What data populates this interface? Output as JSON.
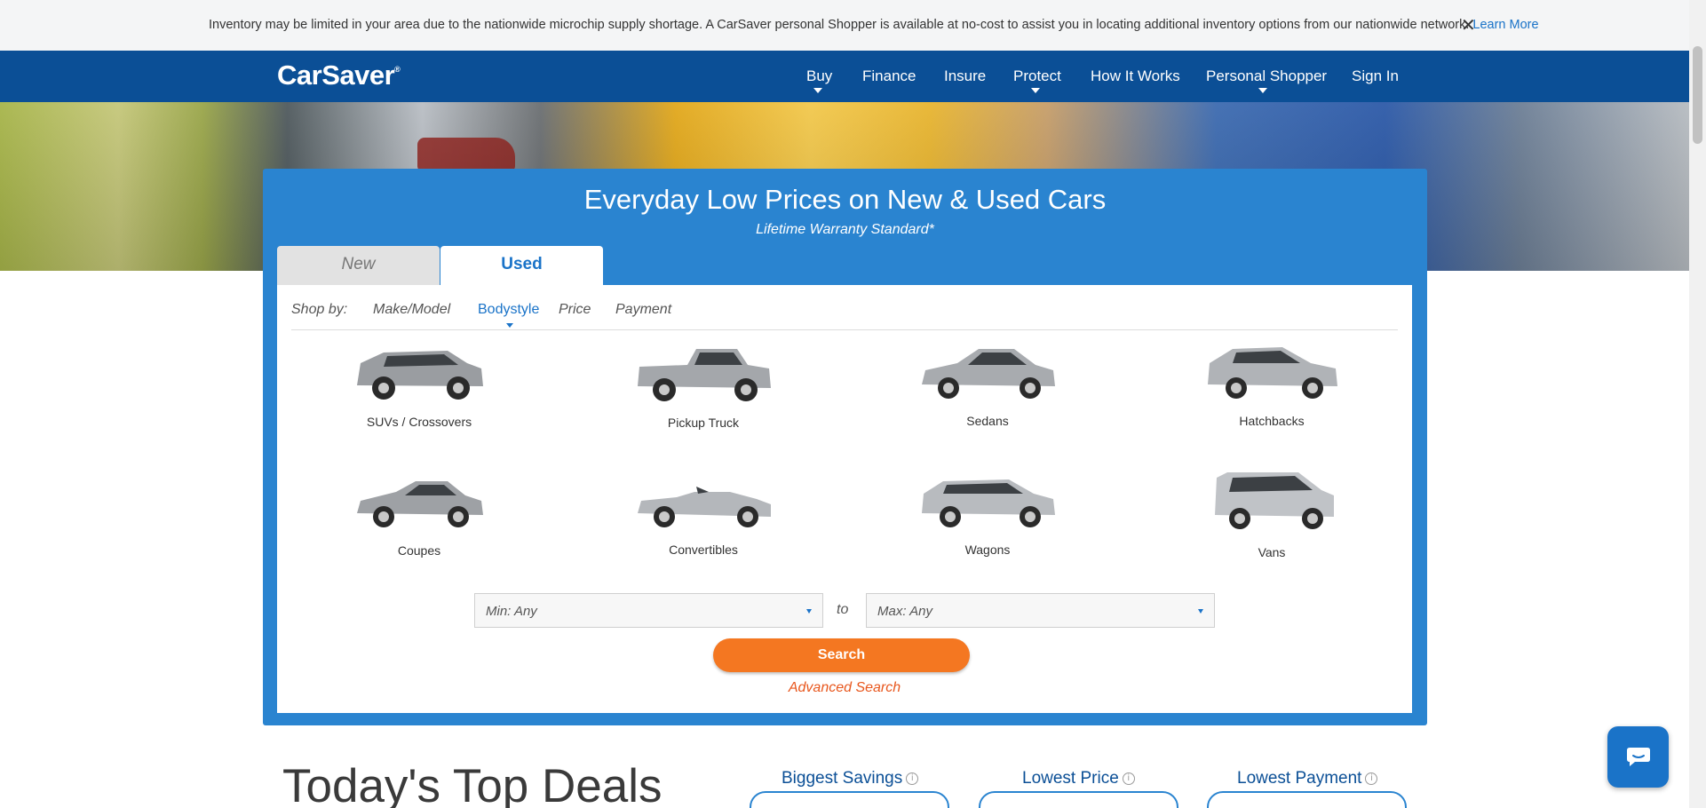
{
  "notice": {
    "text": "Inventory may be limited in your area due to the nationwide microchip supply shortage. A CarSaver personal Shopper is available at no-cost to assist you in locating additional inventory options from our nationwide network.",
    "link": "Learn More",
    "close": "✕"
  },
  "brand": {
    "name": "CarSaver",
    "mark": "®"
  },
  "nav": {
    "buy": "Buy",
    "finance": "Finance",
    "insure": "Insure",
    "protect": "Protect",
    "how_it_works": "How It Works",
    "personal_shopper": "Personal Shopper",
    "sign_in": "Sign In"
  },
  "panel": {
    "title": "Everyday Low Prices on New & Used Cars",
    "subtitle": "Lifetime Warranty Standard*",
    "tabs": {
      "new": "New",
      "used": "Used",
      "active": "Used"
    },
    "shop_by": {
      "label": "Shop by:",
      "make_model": "Make/Model",
      "bodystyle": "Bodystyle",
      "price": "Price",
      "payment": "Payment",
      "active": "Bodystyle"
    },
    "bodystyles": [
      {
        "label": "SUVs / Crossovers"
      },
      {
        "label": "Pickup Truck"
      },
      {
        "label": "Sedans"
      },
      {
        "label": "Hatchbacks"
      },
      {
        "label": "Coupes"
      },
      {
        "label": "Convertibles"
      },
      {
        "label": "Wagons"
      },
      {
        "label": "Vans"
      }
    ],
    "min_select": "Min: Any",
    "to": "to",
    "max_select": "Max: Any",
    "search": "Search",
    "advanced_search": "Advanced Search"
  },
  "deals": {
    "title": "Today's Top Deals",
    "biggest_savings": "Biggest Savings",
    "lowest_price": "Lowest Price",
    "lowest_payment": "Lowest Payment"
  },
  "colors": {
    "nav_bg": "#0b4f96",
    "panel_bg": "#2a84d0",
    "accent_blue": "#1a73c8",
    "search_orange": "#f47721"
  },
  "icons": [
    "close-icon",
    "chevron-down-icon",
    "info-icon",
    "chat-icon"
  ]
}
